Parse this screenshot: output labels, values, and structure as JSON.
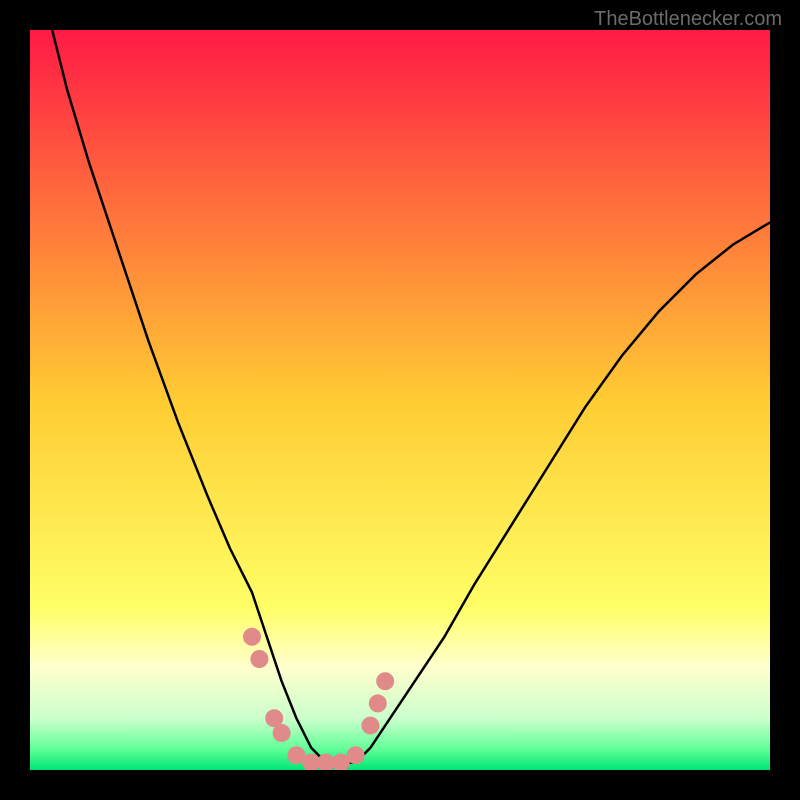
{
  "watermark": "TheBottlenecker.com",
  "chart_data": {
    "type": "line",
    "title": "",
    "xlabel": "",
    "ylabel": "",
    "xlim": [
      0,
      100
    ],
    "ylim": [
      0,
      100
    ],
    "grid": false,
    "background": {
      "gradient_stops": [
        {
          "offset": 0.0,
          "color": "#ff1a45"
        },
        {
          "offset": 0.5,
          "color": "#ffcc33"
        },
        {
          "offset": 0.78,
          "color": "#ffff66"
        },
        {
          "offset": 0.86,
          "color": "#ffffcc"
        },
        {
          "offset": 0.93,
          "color": "#ccffcc"
        },
        {
          "offset": 0.97,
          "color": "#66ff99"
        },
        {
          "offset": 1.0,
          "color": "#00e676"
        }
      ]
    },
    "series": [
      {
        "name": "curve",
        "color": "#000000",
        "x": [
          3,
          5,
          8,
          12,
          16,
          20,
          24,
          27,
          30,
          32,
          34,
          36,
          38,
          40,
          44,
          46,
          48,
          52,
          56,
          60,
          65,
          70,
          75,
          80,
          85,
          90,
          95,
          100
        ],
        "y": [
          100,
          92,
          82,
          70,
          58,
          47,
          37,
          30,
          24,
          18,
          12,
          7,
          3,
          1,
          1,
          3,
          6,
          12,
          18,
          25,
          33,
          41,
          49,
          56,
          62,
          67,
          71,
          74
        ]
      }
    ],
    "markers": {
      "color": "#e08a8a",
      "x": [
        30,
        31,
        33,
        34,
        36,
        38,
        40,
        42,
        44,
        46,
        47,
        48
      ],
      "y": [
        18,
        15,
        7,
        5,
        2,
        1,
        1,
        1,
        2,
        6,
        9,
        12
      ]
    }
  }
}
